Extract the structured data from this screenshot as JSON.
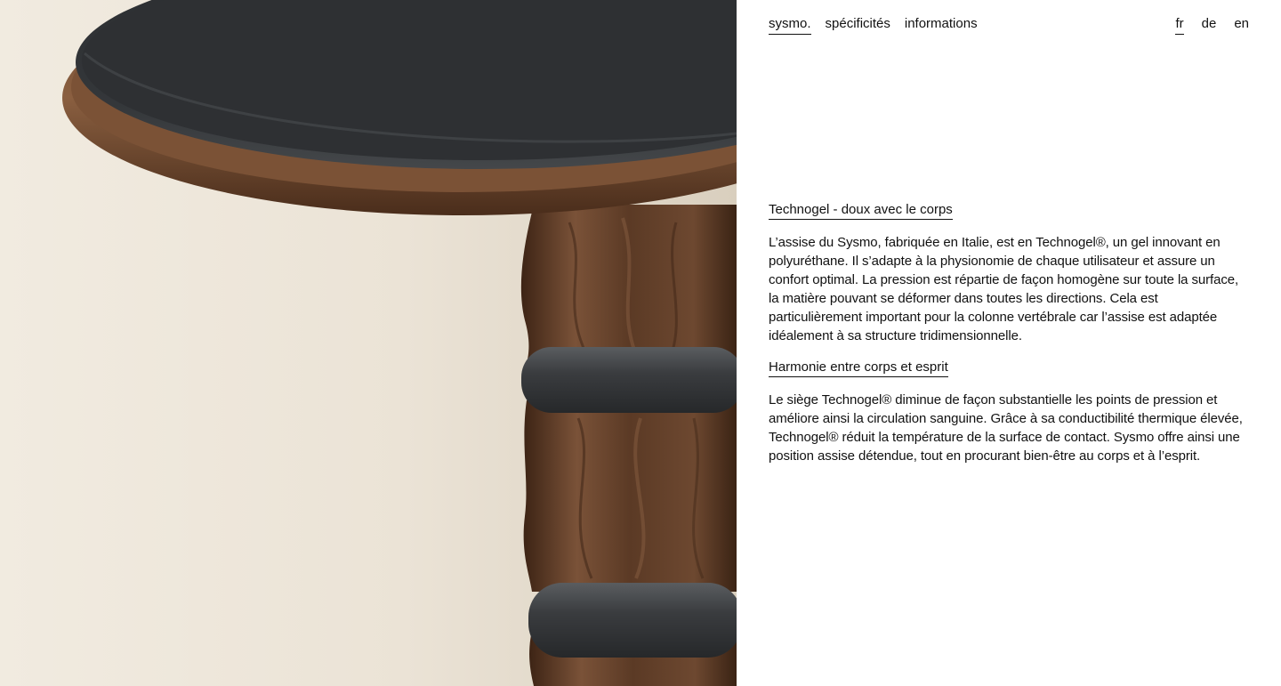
{
  "nav": {
    "brand": "sysmo.",
    "items": [
      {
        "label": "spécificités"
      },
      {
        "label": "informations"
      }
    ]
  },
  "lang": {
    "active": "fr",
    "items": [
      {
        "label": "fr"
      },
      {
        "label": "de"
      },
      {
        "label": "en"
      }
    ]
  },
  "sections": [
    {
      "title": "Technogel - doux avec le corps",
      "body": "L’assise du Sysmo, fabriquée en Italie, est en Technogel®, un gel innovant en polyuréthane. Il s’adapte à la physionomie de chaque utilisateur et assure un confort optimal. La pression est répartie de façon homogène sur toute la surface, la matière pouvant se déformer dans toutes les directions. Cela est particulièrement important pour la colonne vertébrale car l’assise est adaptée idéalement à sa structure tridimensionnelle."
    },
    {
      "title": "Harmonie entre corps et esprit",
      "body": "Le siège Technogel® diminue de façon substantielle les points de pression et améliore ainsi la circulation sanguine. Grâce à sa conductibilité thermique élevée, Technogel® réduit la température de la surface de contact. Sysmo offre ainsi une position assise détendue, tout en procurant bien-être au corps et à l’esprit."
    }
  ],
  "colors": {
    "wood": "#5a3a24",
    "seat": "#2f3134",
    "background": "#ede6da"
  }
}
